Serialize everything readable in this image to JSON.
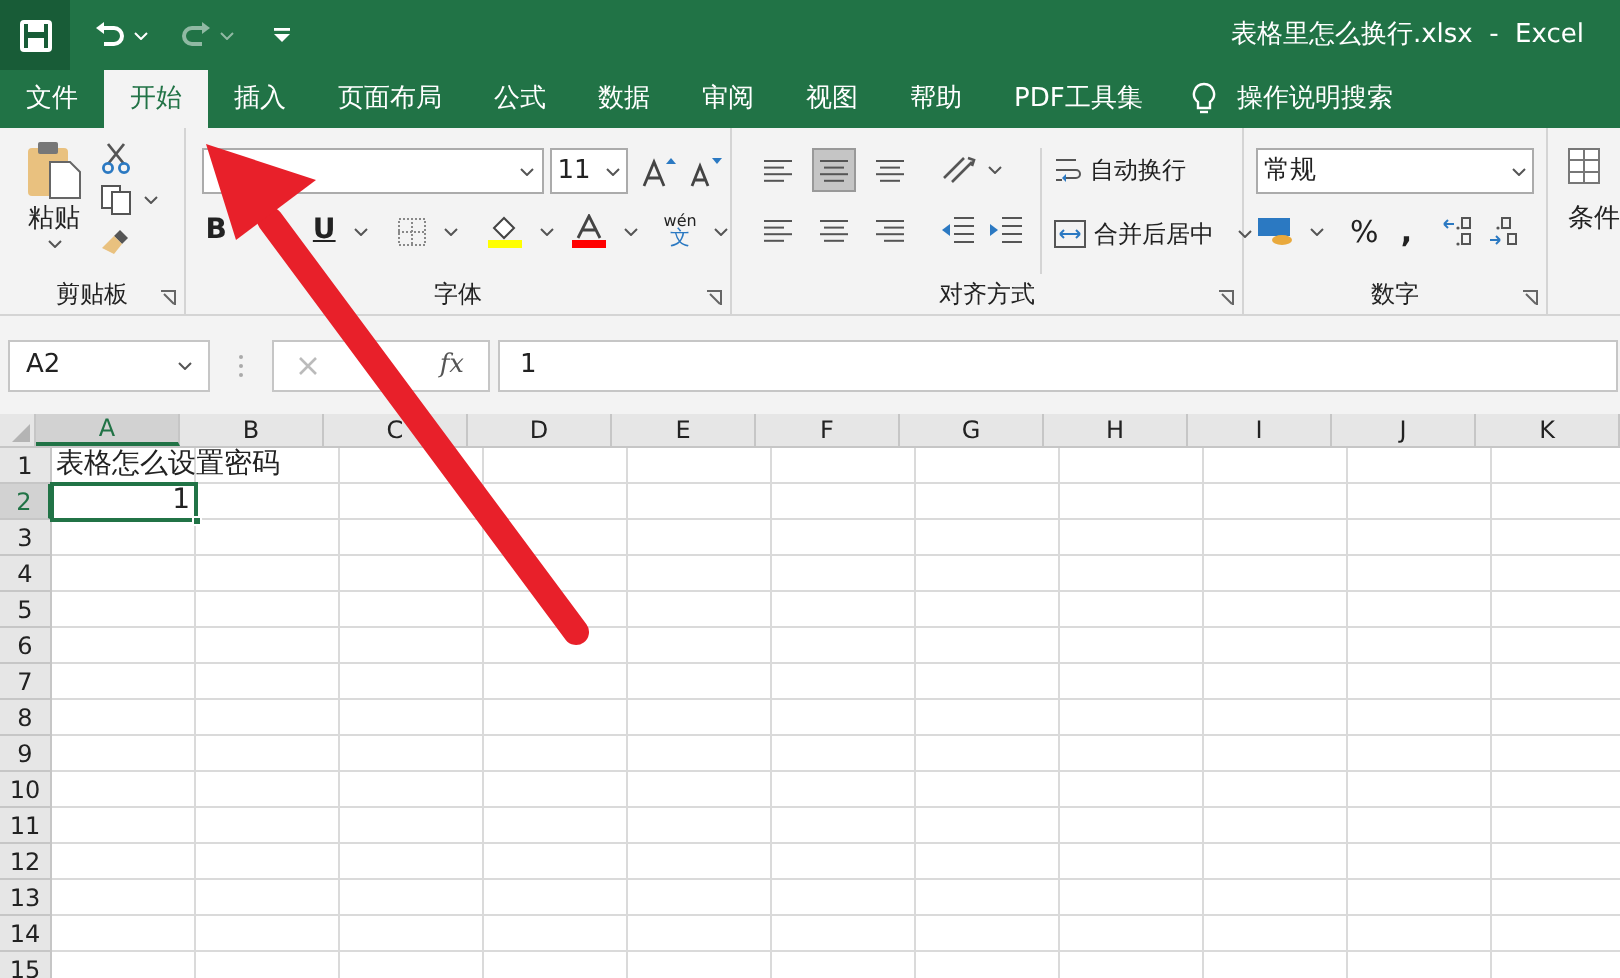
{
  "window": {
    "title": "表格里怎么换行.xlsx  -  Excel"
  },
  "tabs": [
    {
      "label": "文件",
      "selected": false
    },
    {
      "label": "开始",
      "selected": true
    },
    {
      "label": "插入",
      "selected": false
    },
    {
      "label": "页面布局",
      "selected": false
    },
    {
      "label": "公式",
      "selected": false
    },
    {
      "label": "数据",
      "selected": false
    },
    {
      "label": "审阅",
      "selected": false
    },
    {
      "label": "视图",
      "selected": false
    },
    {
      "label": "帮助",
      "selected": false
    },
    {
      "label": "PDF工具集",
      "selected": false
    }
  ],
  "tell_me": "操作说明搜索",
  "ribbon": {
    "clipboard": {
      "paste": "粘贴",
      "label": "剪贴板"
    },
    "font": {
      "size": "11",
      "bold": "B",
      "underline": "U",
      "phonetic_top": "wén",
      "phonetic_bottom": "文",
      "label": "字体"
    },
    "alignment": {
      "middle_align_selected": true,
      "wrap_text": "自动换行",
      "merge_center": "合并后居中",
      "label": "对齐方式"
    },
    "number": {
      "format": "常规",
      "percent": "%",
      "comma": ",",
      "label": "数字"
    },
    "next_group": "条件"
  },
  "formula_bar": {
    "name_box": "A2",
    "fx": "fx",
    "value": "1"
  },
  "sheet": {
    "columns": [
      {
        "label": "A",
        "selected": true
      },
      {
        "label": "B",
        "selected": false
      },
      {
        "label": "C",
        "selected": false
      },
      {
        "label": "D",
        "selected": false
      },
      {
        "label": "E",
        "selected": false
      },
      {
        "label": "F",
        "selected": false
      },
      {
        "label": "G",
        "selected": false
      },
      {
        "label": "H",
        "selected": false
      },
      {
        "label": "I",
        "selected": false
      },
      {
        "label": "J",
        "selected": false
      },
      {
        "label": "K",
        "selected": false
      }
    ],
    "rows": [
      {
        "label": "1",
        "selected": false,
        "cells": [
          "表格怎么设置密码"
        ]
      },
      {
        "label": "2",
        "selected": true,
        "cells": [
          "1"
        ]
      },
      {
        "label": "3",
        "selected": false,
        "cells": []
      },
      {
        "label": "4",
        "selected": false,
        "cells": []
      },
      {
        "label": "5",
        "selected": false,
        "cells": []
      },
      {
        "label": "6",
        "selected": false,
        "cells": []
      },
      {
        "label": "7",
        "selected": false,
        "cells": []
      },
      {
        "label": "8",
        "selected": false,
        "cells": []
      },
      {
        "label": "9",
        "selected": false,
        "cells": []
      },
      {
        "label": "10",
        "selected": false,
        "cells": []
      },
      {
        "label": "11",
        "selected": false,
        "cells": []
      },
      {
        "label": "12",
        "selected": false,
        "cells": []
      },
      {
        "label": "13",
        "selected": false,
        "cells": []
      },
      {
        "label": "14",
        "selected": false,
        "cells": []
      },
      {
        "label": "15",
        "selected": false,
        "cells": []
      }
    ]
  }
}
